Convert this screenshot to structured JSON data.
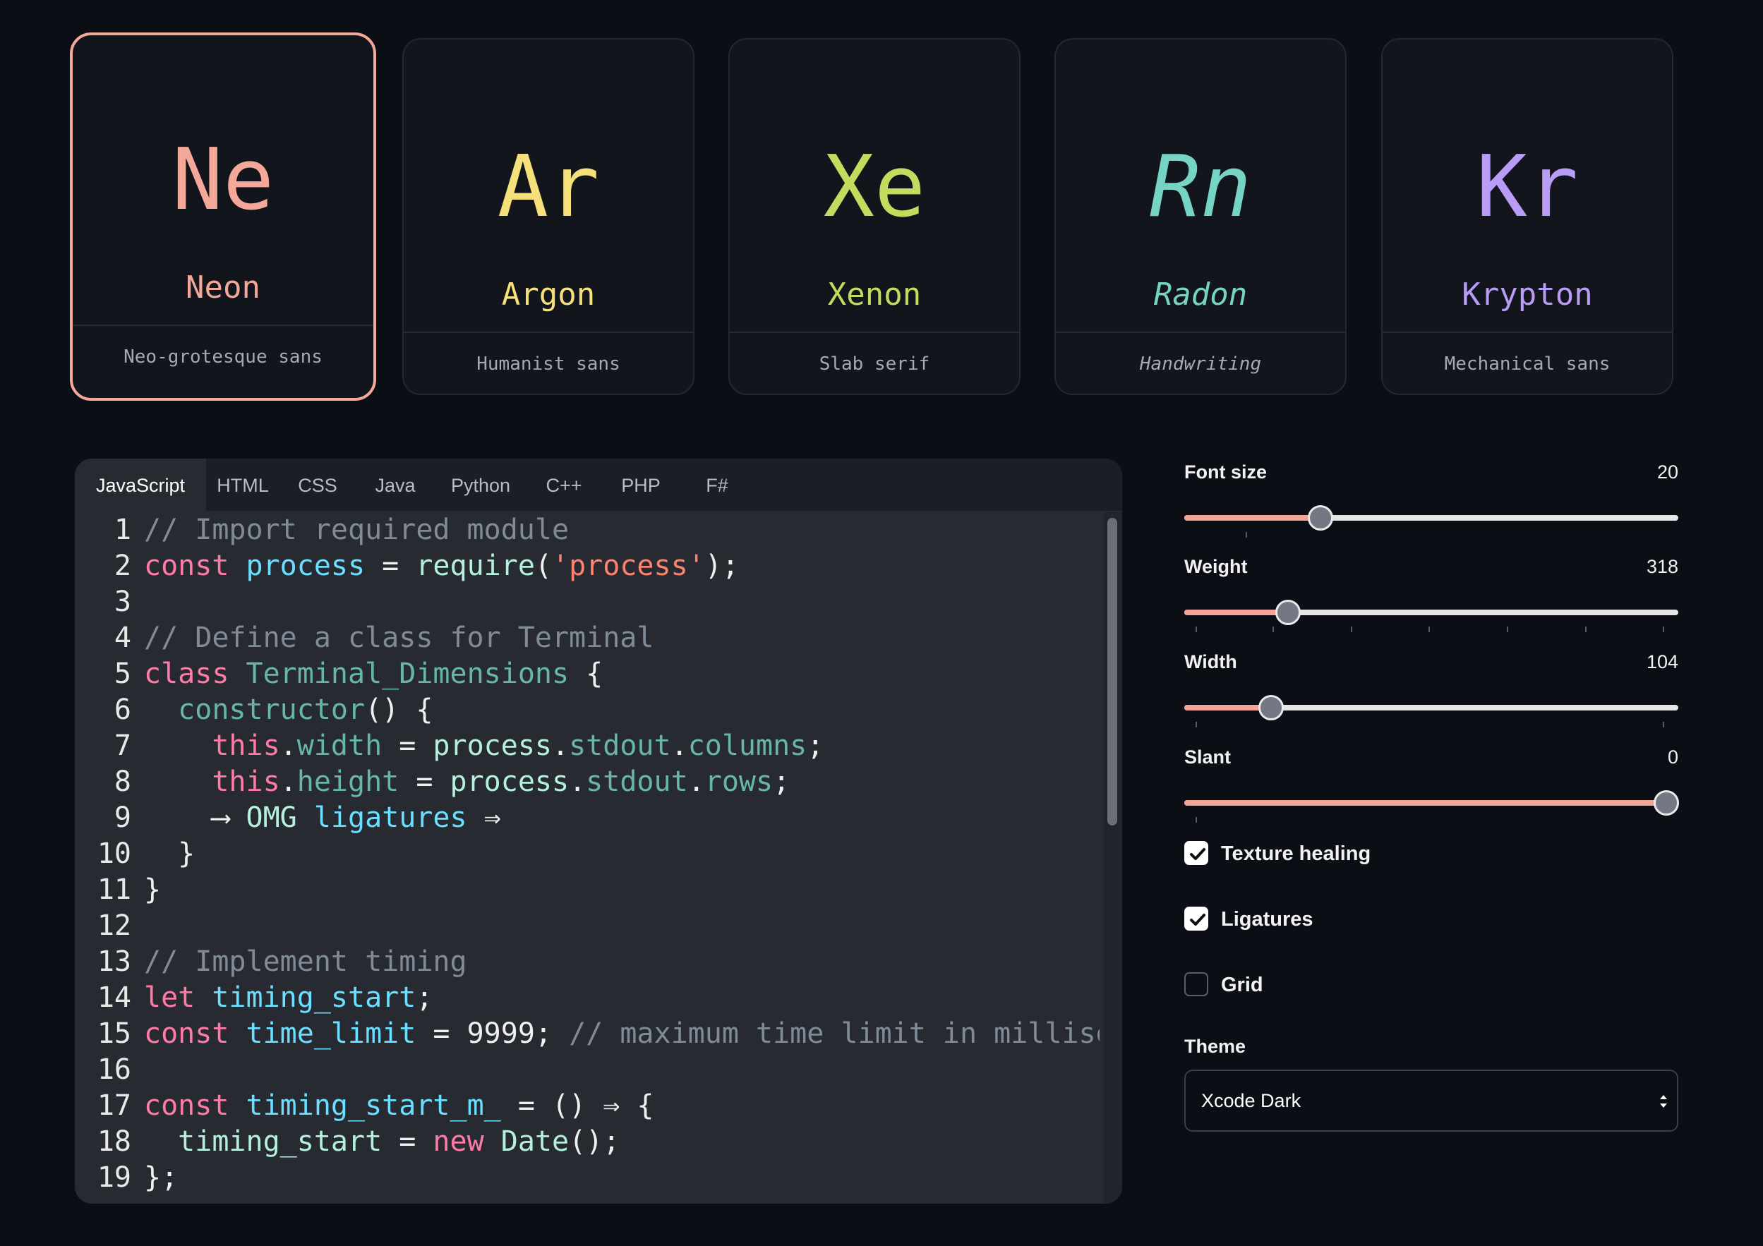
{
  "fonts": [
    {
      "glyph": "Ne",
      "name": "Neon",
      "desc": "Neo-grotesque sans",
      "color": "#f4a89a",
      "selected": true
    },
    {
      "glyph": "Ar",
      "name": "Argon",
      "desc": "Humanist sans",
      "color": "#f5e07a",
      "selected": false
    },
    {
      "glyph": "Xe",
      "name": "Xenon",
      "desc": "Slab serif",
      "color": "#c2dd5d",
      "selected": false
    },
    {
      "glyph": "Rn",
      "name": "Radon",
      "desc": "Handwriting",
      "color": "#76d4c4",
      "selected": false
    },
    {
      "glyph": "Kr",
      "name": "Krypton",
      "desc": "Mechanical sans",
      "color": "#b99cf5",
      "selected": false
    }
  ],
  "tabs": [
    "JavaScript",
    "HTML",
    "CSS",
    "Java",
    "Python",
    "C++",
    "PHP",
    "F#"
  ],
  "active_tab": "JavaScript",
  "code_lines": [
    "1",
    "2",
    "3",
    "4",
    "5",
    "6",
    "7",
    "8",
    "9",
    "10",
    "11",
    "12",
    "13",
    "14",
    "15",
    "16",
    "17",
    "18",
    "19"
  ],
  "code": {
    "l1_comment": "// Import required module",
    "l2_kw": "const",
    "l2_var": "process",
    "l2_eq": " = ",
    "l2_fn": "require",
    "l2_str": "'process'",
    "l4_comment": "// Define a class for Terminal",
    "l5_kw": "class",
    "l5_name": "Terminal_Dimensions",
    "l6_fn": "constructor",
    "l7_this": "this",
    "l7_prop": "width",
    "l7_obj": "process",
    "l7_p1": "stdout",
    "l7_p2": "columns",
    "l8_this": "this",
    "l8_prop": "height",
    "l8_obj": "process",
    "l8_p1": "stdout",
    "l8_p2": "rows",
    "l9_arrow1": "⟶",
    "l9_text": "OMG",
    "l9_var": "ligatures",
    "l9_arrow2": "⇒",
    "l13_comment": "// Implement timing",
    "l14_kw": "let",
    "l14_var": "timing_start",
    "l15_kw": "const",
    "l15_var": "time_limit",
    "l15_num": "9999",
    "l15_comment": "// maximum time limit in millisec",
    "l17_kw": "const",
    "l17_var": "timing_start_m_",
    "l17_arrow": "⇒",
    "l18_var": "timing_start",
    "l18_kw": "new",
    "l18_fn": "Date"
  },
  "controls": {
    "font_size": {
      "label": "Font size",
      "value": "20",
      "fraction": 0.275
    },
    "weight": {
      "label": "Weight",
      "value": "318",
      "fraction": 0.21
    },
    "width": {
      "label": "Width",
      "value": "104",
      "fraction": 0.175
    },
    "slant": {
      "label": "Slant",
      "value": "0",
      "fraction": 0.975
    },
    "texture_healing": {
      "label": "Texture healing",
      "checked": true
    },
    "ligatures": {
      "label": "Ligatures",
      "checked": true
    },
    "grid": {
      "label": "Grid",
      "checked": false
    },
    "theme": {
      "label": "Theme",
      "value": "Xcode Dark"
    }
  },
  "colors": {
    "accent": "#f2a596",
    "background": "#0b0e14",
    "editor": "#282a32"
  }
}
